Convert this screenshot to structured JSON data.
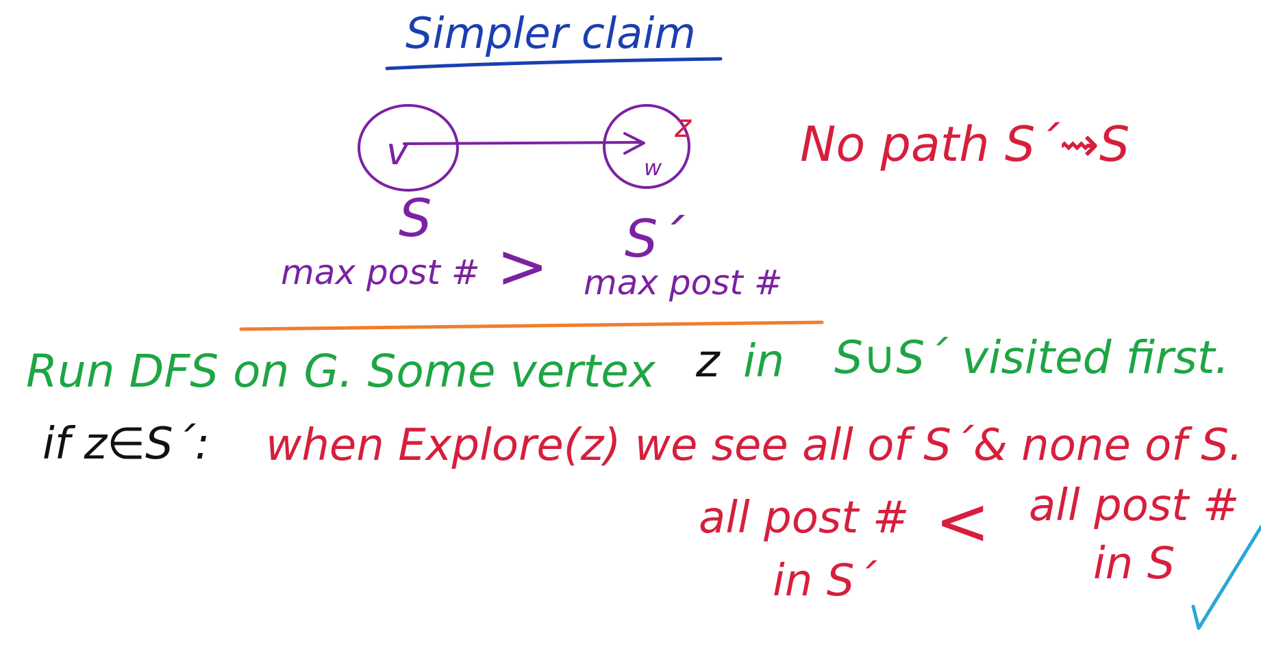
{
  "title": "Simpler claim",
  "diagram": {
    "left_node_label": "v",
    "right_node_label": "w",
    "right_node_mark": "z",
    "left_set": "S",
    "right_set": "S´",
    "left_caption": "max post #",
    "compare": ">",
    "right_caption": "max post #"
  },
  "note": "No path S´⇝S",
  "line1": {
    "part_a": "Run DFS on G. Some vertex",
    "z": "z",
    "in": "in",
    "part_b": "S∪S´ visited first."
  },
  "line2": {
    "cond": "if z∈S´:",
    "text": "when Explore(z) we see all of S´& none of S."
  },
  "compare2": {
    "left_top": "all post #",
    "left_bottom": "in S´",
    "op": "<",
    "right_top": "all post #",
    "right_bottom": "in S"
  },
  "colors": {
    "title": "#1a3fb0",
    "diagram": "#7b22a2",
    "note": "#d61f3c",
    "statement": "#1ea544",
    "divider": "#f07d2c",
    "check": "#2aa6d8"
  }
}
